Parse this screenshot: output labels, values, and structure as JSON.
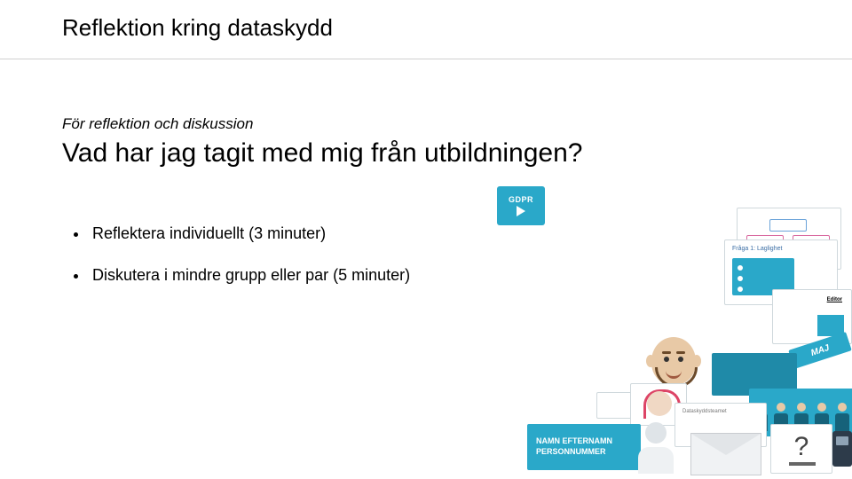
{
  "header": {
    "title": "Reflektion kring dataskydd"
  },
  "content": {
    "subtitle": "För reflektion och diskussion",
    "question": "Vad har jag tagit med mig från utbildningen?",
    "bullets": [
      "Reflektera individuellt (3 minuter)",
      "Diskutera i mindre grupp eller par (5 minuter)"
    ]
  },
  "collage": {
    "gdpr_label": "GDPR",
    "maj_label": "MAJ",
    "laglighet_label": "Fråga 1: Laglighet",
    "editor_label": "Editor",
    "card_title": "Dataskyddsteamet",
    "namn_line1": "NAMN EFTERNAMN",
    "namn_line2": "PERSONNUMMER",
    "question_mark": "?"
  }
}
